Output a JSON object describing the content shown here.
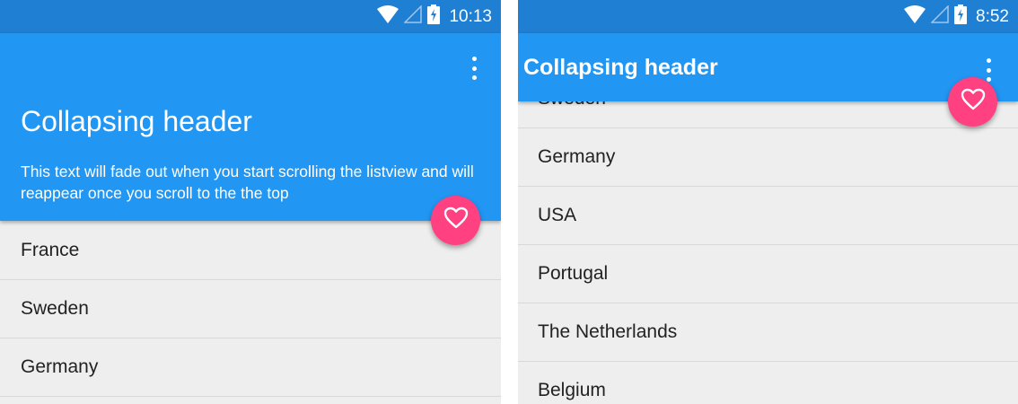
{
  "colors": {
    "status_bar": "#1e7fd3",
    "app_bar": "#2196f3",
    "fab": "#ff4081",
    "list_background": "#eeeeee"
  },
  "left_screen": {
    "status_bar": {
      "time": "10:13",
      "icons": [
        "wifi-icon",
        "signal-icon",
        "battery-charging-icon"
      ]
    },
    "header": {
      "title": "Collapsing header",
      "subtitle": "This text will fade out when you start scrolling the listview and will reappear once you scroll to the the top",
      "overflow_icon": "more-vert-icon"
    },
    "fab_icon": "heart-outline-icon",
    "list_items": [
      "France",
      "Sweden",
      "Germany"
    ]
  },
  "right_screen": {
    "status_bar": {
      "time": "8:52",
      "icons": [
        "wifi-icon",
        "signal-icon",
        "battery-charging-icon"
      ]
    },
    "header": {
      "title": "Collapsing header",
      "overflow_icon": "more-vert-icon"
    },
    "fab_icon": "heart-outline-icon",
    "list_items": [
      "Sweden",
      "Germany",
      "USA",
      "Portugal",
      "The Netherlands",
      "Belgium"
    ]
  }
}
